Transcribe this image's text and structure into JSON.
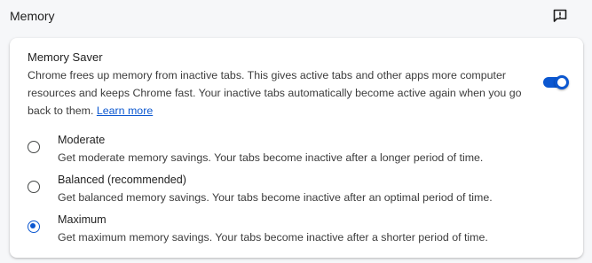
{
  "section": {
    "title": "Memory",
    "feedback_icon": "feedback-icon"
  },
  "memory_saver": {
    "title": "Memory Saver",
    "description": "Chrome frees up memory from inactive tabs. This gives active tabs and other apps more computer resources and keeps Chrome fast. Your inactive tabs automatically become active again when you go back to them.",
    "learn_more": "Learn more",
    "enabled": true
  },
  "options": [
    {
      "label": "Moderate",
      "description": "Get moderate memory savings. Your tabs become inactive after a longer period of time.",
      "selected": false
    },
    {
      "label": "Balanced (recommended)",
      "description": "Get balanced memory savings. Your tabs become inactive after an optimal period of time.",
      "selected": false
    },
    {
      "label": "Maximum",
      "description": "Get maximum memory savings. Your tabs become inactive after a shorter period of time.",
      "selected": true
    }
  ],
  "colors": {
    "accent": "#0b57d0",
    "background": "#f6f7f9",
    "card": "#ffffff"
  }
}
